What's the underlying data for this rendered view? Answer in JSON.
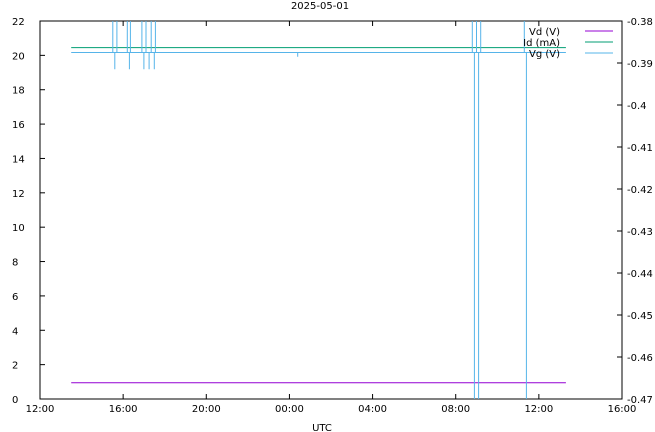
{
  "chart_data": {
    "type": "line",
    "title": "2025-05-01",
    "xlabel": "UTC",
    "ylabel": "",
    "y2label": "",
    "x_ticks": [
      "12:00",
      "16:00",
      "20:00",
      "00:00",
      "04:00",
      "08:00",
      "12:00",
      "16:00"
    ],
    "x_range_hours": [
      0,
      28
    ],
    "ylim": [
      0,
      22
    ],
    "y_ticks": [
      "0",
      "2",
      "4",
      "6",
      "8",
      "10",
      "12",
      "14",
      "16",
      "18",
      "20",
      "22"
    ],
    "y2lim": [
      -0.47,
      -0.38
    ],
    "y2_ticks": [
      "-0.47",
      "-0.46",
      "-0.45",
      "-0.44",
      "-0.43",
      "-0.42",
      "-0.41",
      "-0.4",
      "-0.39",
      "-0.38"
    ],
    "grid": false,
    "legend_position": "top-right",
    "series": [
      {
        "name": "Vd (V)",
        "axis": "left",
        "color": "#9400d3",
        "points": [
          [
            1.5,
            0.95
          ],
          [
            25.3,
            0.95
          ]
        ]
      },
      {
        "name": "Id (mA)",
        "axis": "left",
        "color": "#009e73",
        "points": [
          [
            1.5,
            20.45
          ],
          [
            25.3,
            20.45
          ]
        ]
      },
      {
        "name": "Vg (V)",
        "axis": "right",
        "color": "#56b4e9",
        "base": -0.3875,
        "spikes": [
          {
            "x": 3.5,
            "y": -0.38
          },
          {
            "x": 3.6,
            "y": -0.3915
          },
          {
            "x": 3.7,
            "y": -0.38
          },
          {
            "x": 4.2,
            "y": -0.38
          },
          {
            "x": 4.3,
            "y": -0.3915
          },
          {
            "x": 4.35,
            "y": -0.38
          },
          {
            "x": 4.9,
            "y": -0.38
          },
          {
            "x": 5.0,
            "y": -0.3915
          },
          {
            "x": 5.1,
            "y": -0.38
          },
          {
            "x": 5.25,
            "y": -0.3915
          },
          {
            "x": 5.35,
            "y": -0.38
          },
          {
            "x": 5.5,
            "y": -0.3915
          },
          {
            "x": 5.55,
            "y": -0.38
          },
          {
            "x": 12.4,
            "y": -0.3885
          },
          {
            "x": 20.8,
            "y": -0.38
          },
          {
            "x": 20.9,
            "y": -0.47
          },
          {
            "x": 21.0,
            "y": -0.38
          },
          {
            "x": 21.1,
            "y": -0.47
          },
          {
            "x": 21.2,
            "y": -0.38
          },
          {
            "x": 23.3,
            "y": -0.38
          },
          {
            "x": 23.4,
            "y": -0.47
          }
        ]
      }
    ]
  }
}
